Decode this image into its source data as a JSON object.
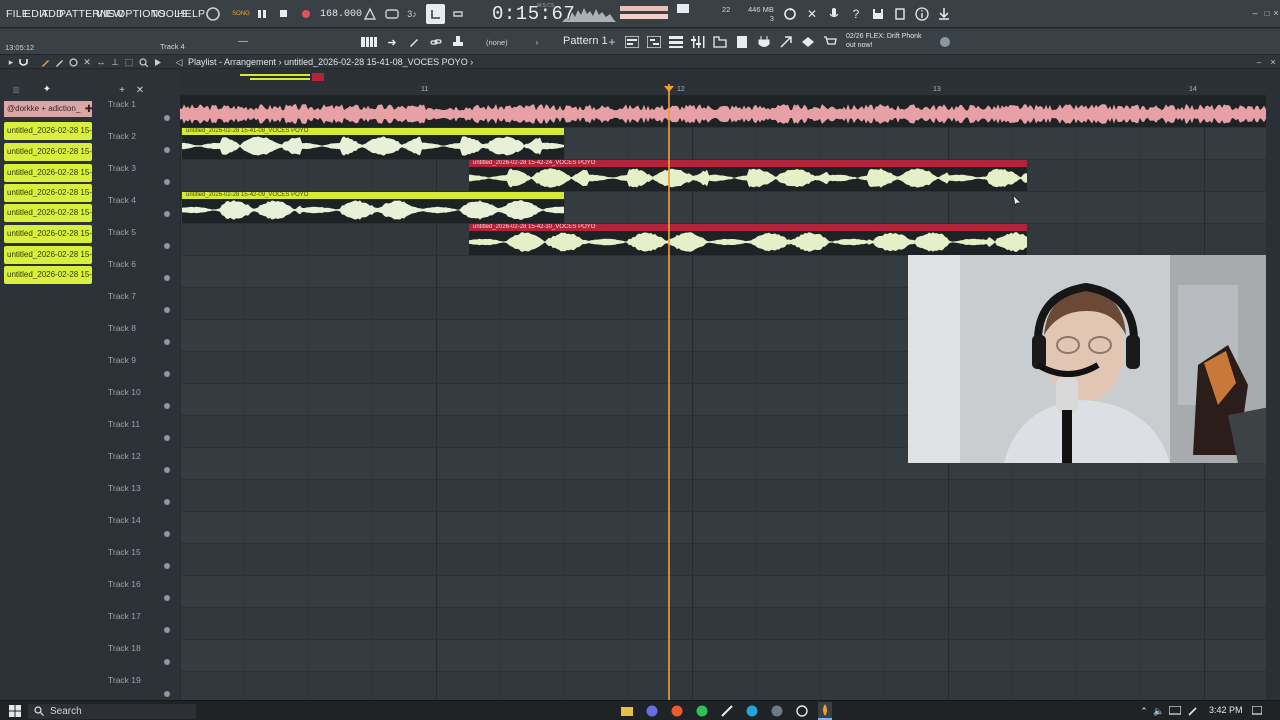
{
  "menu": [
    "FILE",
    "EDIT",
    "ADD",
    "PATTERNS",
    "VIEW",
    "OPTIONS",
    "TOOLS",
    "HELP"
  ],
  "transport": {
    "song_label": "SONG",
    "pat_label": "PAT",
    "bpm": "168.000",
    "time": "0:15:67",
    "time_unit": "M:S:CS"
  },
  "memory": {
    "cpu": "22",
    "ram": "446 MB",
    "voices": "3"
  },
  "toolbar2": {
    "clock": "13:05:12",
    "track_hint": "Track 4",
    "none": "(none)",
    "pattern": "Pattern 1",
    "news_date": "02/26",
    "news_text": "FLEX: Drift Phonk",
    "news_sub": "out now!"
  },
  "playlist": {
    "breadcrumb_root": "Playlist - Arrangement",
    "breadcrumb_sep": "›",
    "breadcrumb_file": "untitled_2026-02-28 15-41-08_VOCES POYO",
    "breadcrumb_end": "›"
  },
  "picker": {
    "first": "@dorkke + adiction_",
    "items": [
      "untitled_2026-02-28 15-",
      "untitled_2026-02-28 15-",
      "untitled_2026-02-28 15-",
      "untitled_2026-02-28 15-",
      "untitled_2026-02-28 15-",
      "untitled_2026-02-28 15-",
      "untitled_2026-02-28 15-",
      "untitled_2026-02-28 15-"
    ]
  },
  "tracks": [
    "Track 1",
    "Track 2",
    "Track 3",
    "Track 4",
    "Track 5",
    "Track 6",
    "Track 7",
    "Track 8",
    "Track 9",
    "Track 10",
    "Track 11",
    "Track 12",
    "Track 13",
    "Track 14",
    "Track 15",
    "Track 16",
    "Track 17",
    "Track 18",
    "Track 19"
  ],
  "ruler": [
    "11",
    "12",
    "13",
    "14"
  ],
  "clips": [
    {
      "label": "untitled_2026-02-28 15-41-08_VOCES POYO",
      "color": "y"
    },
    {
      "label": "untitled_2026-02-28 15-42-24_VOCES POYO",
      "color": "r"
    },
    {
      "label": "untitled_2026-02-28 15-42-09_VOCES POYO",
      "color": "y"
    },
    {
      "label": "untitled_2026-02-28 15-42-30_VOCES POYO",
      "color": "r"
    }
  ],
  "taskbar": {
    "search": "Search",
    "time": "3:42 PM"
  },
  "colors": {
    "accent_yellow": "#d4ea36",
    "accent_red": "#b3243a",
    "playhead": "#e59b3c"
  }
}
